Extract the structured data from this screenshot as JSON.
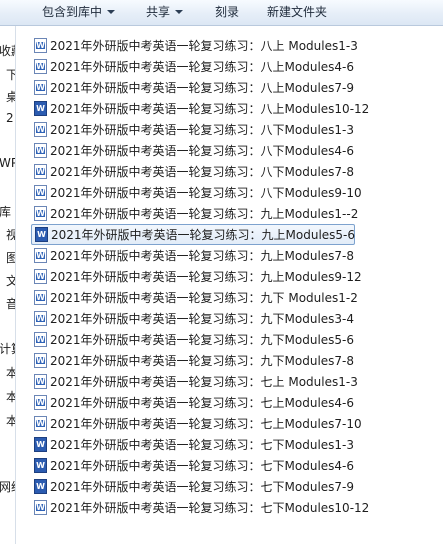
{
  "toolbar": {
    "include_label": "包含到库中",
    "share_label": "共享",
    "burn_label": "刻录",
    "new_folder_label": "新建文件夹"
  },
  "nav": {
    "fragments": [
      "收藏",
      "下",
      "桌",
      "2",
      "WP",
      "库",
      "视",
      "图",
      "文",
      "音",
      "计算",
      "本",
      "本",
      "本",
      "网络"
    ]
  },
  "files": [
    {
      "name": "2021年外研版中考英语一轮复习练习：八上 Modules1-3",
      "type": "doc"
    },
    {
      "name": "2021年外研版中考英语一轮复习练习：八上Modules4-6",
      "type": "doc"
    },
    {
      "name": "2021年外研版中考英语一轮复习练习：八上Modules7-9",
      "type": "doc"
    },
    {
      "name": "2021年外研版中考英语一轮复习练习：八上Modules10-12",
      "type": "docx"
    },
    {
      "name": "2021年外研版中考英语一轮复习练习：八下Modules1-3",
      "type": "doc"
    },
    {
      "name": "2021年外研版中考英语一轮复习练习：八下Modules4-6",
      "type": "doc"
    },
    {
      "name": "2021年外研版中考英语一轮复习练习：八下Modules7-8",
      "type": "doc"
    },
    {
      "name": "2021年外研版中考英语一轮复习练习：八下Modules9-10",
      "type": "doc"
    },
    {
      "name": "2021年外研版中考英语一轮复习练习：九上Modules1--2",
      "type": "doc"
    },
    {
      "name": "2021年外研版中考英语一轮复习练习：九上Modules5-6",
      "type": "docx",
      "selected": true
    },
    {
      "name": "2021年外研版中考英语一轮复习练习：九上Modules7-8",
      "type": "doc"
    },
    {
      "name": "2021年外研版中考英语一轮复习练习：九上Modules9-12",
      "type": "doc"
    },
    {
      "name": "2021年外研版中考英语一轮复习练习：九下 Modules1-2",
      "type": "doc"
    },
    {
      "name": "2021年外研版中考英语一轮复习练习：九下Modules3-4",
      "type": "doc"
    },
    {
      "name": "2021年外研版中考英语一轮复习练习：九下Modules5-6",
      "type": "doc"
    },
    {
      "name": "2021年外研版中考英语一轮复习练习：九下Modules7-8",
      "type": "doc"
    },
    {
      "name": "2021年外研版中考英语一轮复习练习：七上 Modules1-3",
      "type": "doc"
    },
    {
      "name": "2021年外研版中考英语一轮复习练习：七上Modules4-6",
      "type": "doc"
    },
    {
      "name": "2021年外研版中考英语一轮复习练习：七上Modules7-10",
      "type": "doc"
    },
    {
      "name": "2021年外研版中考英语一轮复习练习：七下Modules1-3",
      "type": "docx"
    },
    {
      "name": "2021年外研版中考英语一轮复习练习：七下Modules4-6",
      "type": "docx"
    },
    {
      "name": "2021年外研版中考英语一轮复习练习：七下Modules7-9",
      "type": "docx"
    },
    {
      "name": "2021年外研版中考英语一轮复习练习：七下Modules10-12",
      "type": "doc"
    }
  ],
  "icons": {
    "file_icon": "word-document-icon"
  },
  "colors": {
    "selection_border": "#7da2ce",
    "word_blue": "#2b5bb0"
  }
}
